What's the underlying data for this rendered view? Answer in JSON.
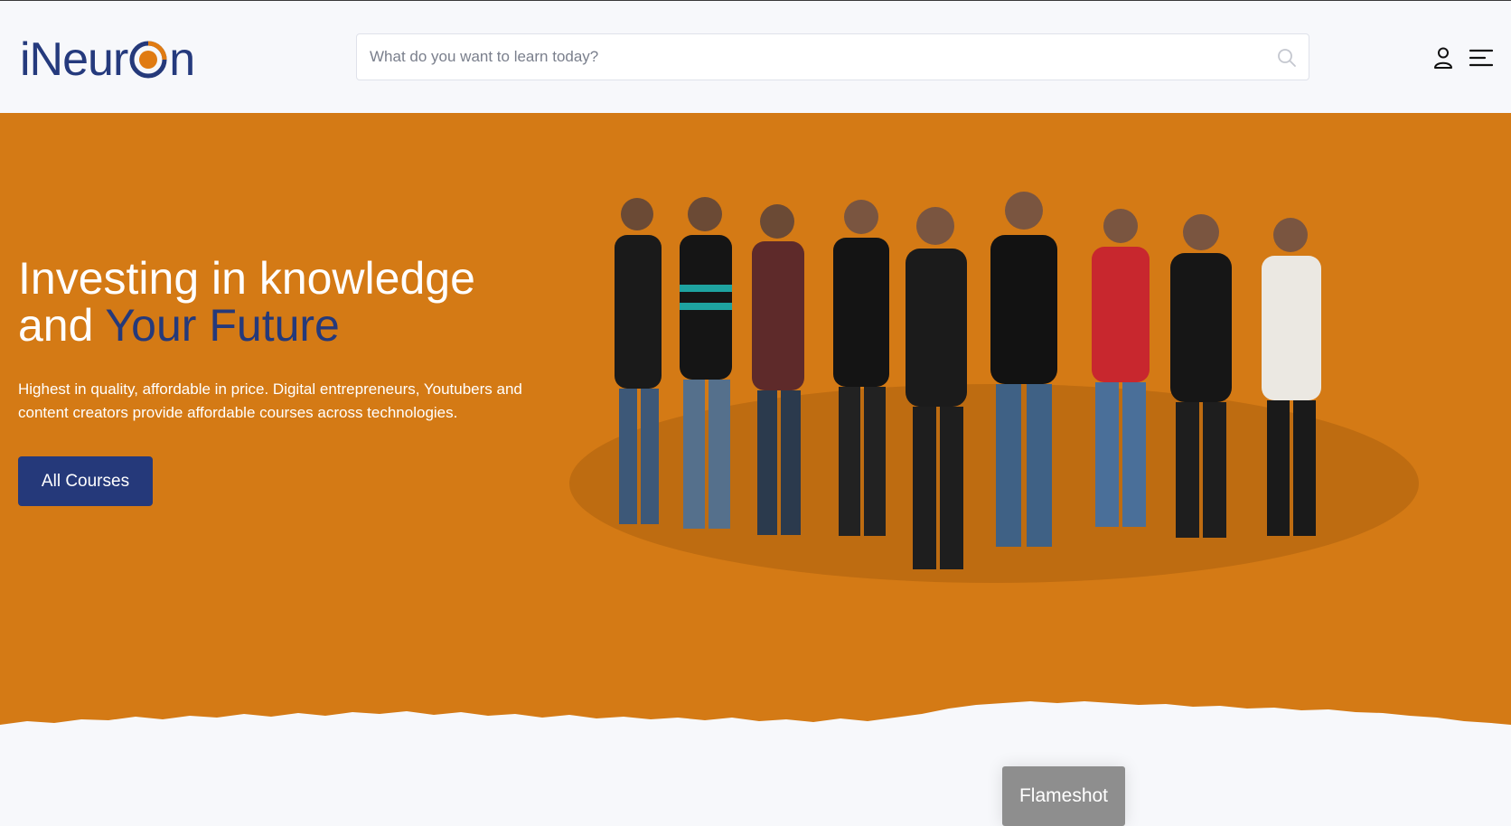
{
  "brand": {
    "logo_prefix": "iNeur",
    "logo_suffix": "n",
    "primary_color": "#25397a",
    "accent_color": "#d47a15"
  },
  "search": {
    "placeholder": "What do you want to learn today?",
    "value": "",
    "icon": "search-icon"
  },
  "nav": {
    "icons": [
      "user-icon",
      "menu-icon"
    ]
  },
  "hero": {
    "title_line1": "Investing in knowledge",
    "title_line2_prefix": "and ",
    "title_line2_accent": "Your Future",
    "subtitle": "Highest in quality, affordable in price. Digital entrepreneurs, Youtubers and content creators provide affordable courses across technologies.",
    "cta_label": "All Courses",
    "background_color": "#d47a15"
  },
  "overlay": {
    "label": "Flameshot"
  }
}
